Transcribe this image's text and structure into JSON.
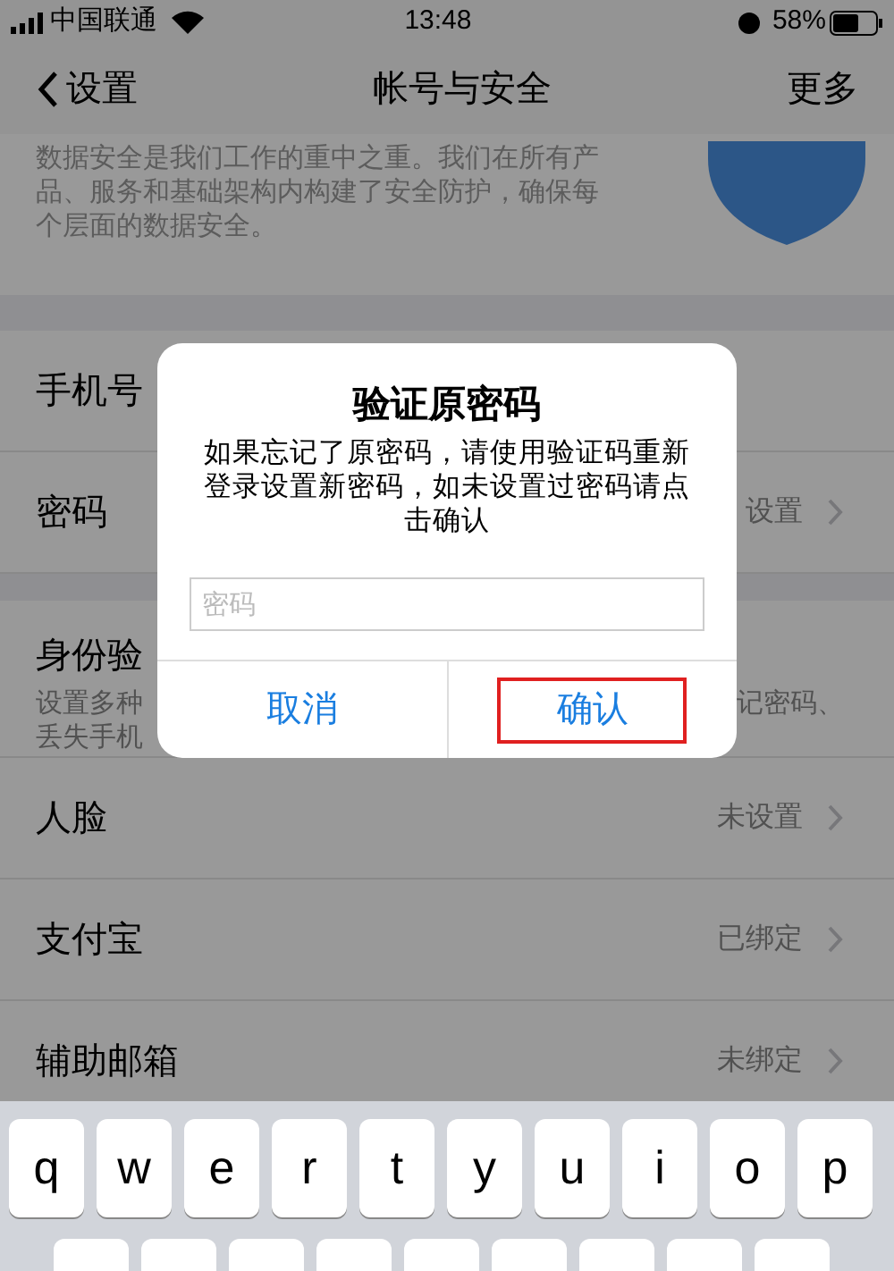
{
  "status_bar": {
    "carrier": "中国联通",
    "time": "13:48",
    "battery": "58%"
  },
  "nav": {
    "back": "设置",
    "title": "帐号与安全",
    "more": "更多"
  },
  "intro": {
    "text": "数据安全是我们工作的重中之重。我们在所有产品、服务和基础架构内构建了安全防护，确保每个层面的数据安全。"
  },
  "rows": [
    {
      "kind": "plain",
      "label": "手机号"
    },
    {
      "kind": "value",
      "label": "密码",
      "value": "设置"
    },
    {
      "kind": "section",
      "label": "身份验",
      "desc_left": [
        "设置多种",
        "丢失手机"
      ],
      "desc_right": "记密码、"
    },
    {
      "kind": "value",
      "label": "人脸",
      "value": "未设置"
    },
    {
      "kind": "value",
      "label": "支付宝",
      "value": "已绑定"
    },
    {
      "kind": "value",
      "label": "辅助邮箱",
      "value": "未绑定"
    }
  ],
  "dialog": {
    "title": "验证原密码",
    "message": "如果忘记了原密码，请使用验证码重新登录设置新密码，如未设置过密码请点击确认",
    "input": {
      "placeholder": "密码"
    },
    "buttons": [
      {
        "label": "取消",
        "highlighted": false
      },
      {
        "label": "确认",
        "highlighted": true
      }
    ]
  },
  "keyboard": {
    "row1": [
      "q",
      "w",
      "e",
      "r",
      "t",
      "y",
      "u",
      "i",
      "o",
      "p"
    ]
  }
}
